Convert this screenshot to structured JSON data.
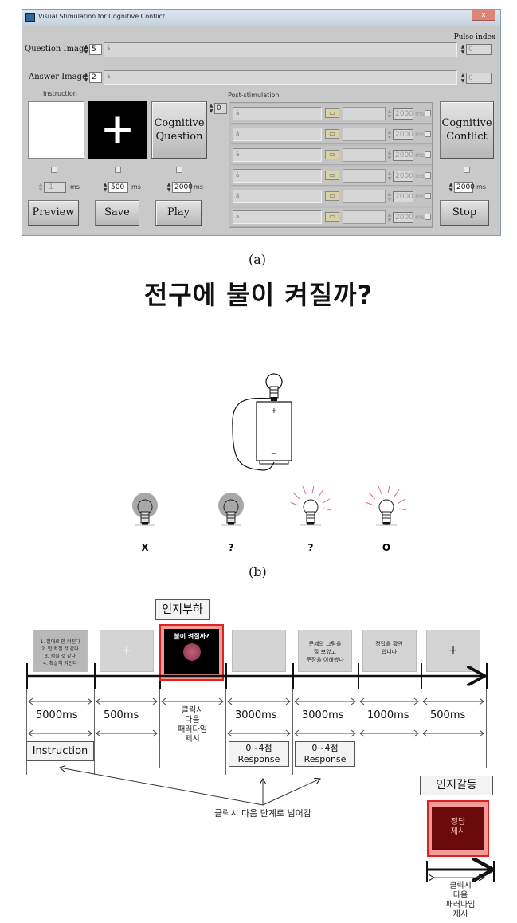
{
  "panel_a": {
    "caption": "(a)",
    "window_title": "Visual Stimulation for Cognitive Conflict",
    "close_label": "x",
    "question_image": {
      "label": "Question Image",
      "value": "5",
      "path_icon": "path-icon"
    },
    "answer_image": {
      "label": "Answer Image",
      "value": "2",
      "path_icon": "path-icon"
    },
    "pulse_index": {
      "label": "Pulse index",
      "values": [
        "0",
        "0"
      ]
    },
    "instruction_label": "Instruction",
    "post_stim_label": "Post-stimulation",
    "post_stim_index": "0",
    "post_stim_rows": [
      {
        "duration": "2000",
        "unit": "ms"
      },
      {
        "duration": "2000",
        "unit": "ms"
      },
      {
        "duration": "2000",
        "unit": "ms"
      },
      {
        "duration": "2000",
        "unit": "ms"
      },
      {
        "duration": "2000",
        "unit": "ms"
      },
      {
        "duration": "2000",
        "unit": "ms"
      }
    ],
    "cognitive_question_label": "Cognitive Question",
    "cognitive_conflict_label": "Cognitive Conflict",
    "durations": [
      {
        "value": "-1",
        "unit": "ms",
        "disabled": true
      },
      {
        "value": "500",
        "unit": "ms"
      },
      {
        "value": "2000",
        "unit": "ms"
      },
      {
        "value": "2000",
        "unit": "ms"
      }
    ],
    "buttons": {
      "preview": "Preview",
      "save": "Save",
      "play": "Play",
      "stop": "Stop"
    },
    "fixation_glyph": "+"
  },
  "panel_b": {
    "caption": "(b)",
    "question": "전구에 불이 켜질까?",
    "battery_plus": "+",
    "battery_minus": "−",
    "bulbs": [
      {
        "state": "off",
        "label": "X"
      },
      {
        "state": "off",
        "label": "?"
      },
      {
        "state": "on",
        "label": "?"
      },
      {
        "state": "on",
        "label": "O"
      }
    ]
  },
  "timeline": {
    "cognitive_load_label": "인지부하",
    "cognitive_conflict_label": "인지갈등",
    "stages": [
      {
        "thumb": "1. 절대로 안 켜진다\n2. 안 켜질 것 같다\n3. 켜질 것 같다\n4. 확실히 켜진다",
        "duration": "5000ms"
      },
      {
        "thumb": "+",
        "duration": "500ms"
      },
      {
        "thumb": "불이 켜질까?",
        "duration": "클릭시\n다음\n패러다임\n제시"
      },
      {
        "thumb": "",
        "duration": "3000ms"
      },
      {
        "thumb": "문제의 그림을\n잘 보았고\n문장을 이해했다",
        "duration": "3000ms"
      },
      {
        "thumb": "정답을 확인\n합니다",
        "duration": "1000ms"
      },
      {
        "thumb": "+",
        "duration": "500ms"
      }
    ],
    "instruction_box": "Instruction",
    "response_boxes": [
      "0~4점\nResponse",
      "0~4점\nResponse"
    ],
    "click_note": "클릭시 다음 단계로 넘어감",
    "answer_thumb": "정답\n제시",
    "answer_note": "클릭시\n다음\n패러다임\n제시"
  }
}
